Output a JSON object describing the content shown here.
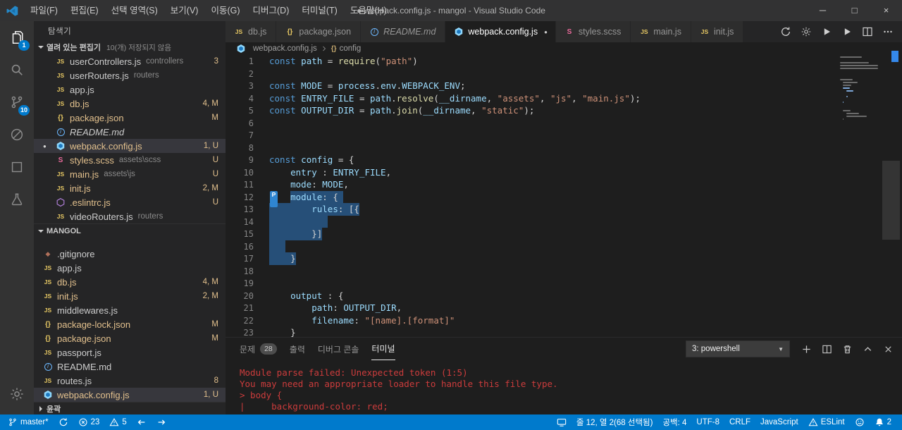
{
  "window": {
    "title": "● webpack.config.js - mangol - Visual Studio Code",
    "menus": [
      "파일(F)",
      "편집(E)",
      "선택 영역(S)",
      "보기(V)",
      "이동(G)",
      "디버그(D)",
      "터미널(T)",
      "도움말(H)"
    ],
    "controls": {
      "minimize": "─",
      "maximize": "□",
      "close": "×"
    }
  },
  "activity_bar": {
    "items": [
      {
        "id": "explorer",
        "icon": "files-icon",
        "badge": "1",
        "active": true
      },
      {
        "id": "search",
        "icon": "search-icon"
      },
      {
        "id": "source-control",
        "icon": "git-branch-icon",
        "badge": "10"
      },
      {
        "id": "debug",
        "icon": "circle-slash-icon"
      },
      {
        "id": "editor-layout",
        "icon": "square-icon"
      },
      {
        "id": "test",
        "icon": "beaker-icon"
      }
    ],
    "bottom_items": [
      {
        "id": "settings",
        "icon": "gear-icon"
      }
    ]
  },
  "sidebar": {
    "title": "탐색기",
    "open_editors": {
      "label": "열려 있는 편집기",
      "note": "10(개) 저장되지 않음",
      "items": [
        {
          "icon": "js",
          "name": "userControllers.js",
          "desc": "controllers",
          "badge": "3"
        },
        {
          "icon": "js",
          "name": "userRouters.js",
          "desc": "routers"
        },
        {
          "icon": "js",
          "name": "app.js"
        },
        {
          "icon": "js",
          "name": "db.js",
          "badge": "4, M",
          "colored": true
        },
        {
          "icon": "json",
          "name": "package.json",
          "badge": "M",
          "colored": true
        },
        {
          "icon": "info",
          "name": "README.md",
          "italic": true
        },
        {
          "icon": "webpack",
          "name": "webpack.config.js",
          "badge": "1, U",
          "colored": true,
          "selected": true,
          "dirty": true
        },
        {
          "icon": "scss",
          "name": "styles.scss",
          "desc": "assets\\scss",
          "badge": "U",
          "colored": true
        },
        {
          "icon": "js",
          "name": "main.js",
          "desc": "assets\\js",
          "badge": "U",
          "colored": true
        },
        {
          "icon": "js",
          "name": "init.js",
          "badge": "2, M",
          "colored": true
        },
        {
          "icon": "eslint",
          "name": ".eslintrc.js",
          "badge": "U",
          "colored": true
        },
        {
          "icon": "js",
          "name": "videoRouters.js",
          "desc": "routers"
        }
      ]
    },
    "folder_section": {
      "label": "MANGOL",
      "items": [
        {
          "icon": "git",
          "name": ".gitignore"
        },
        {
          "icon": "js",
          "name": "app.js"
        },
        {
          "icon": "js",
          "name": "db.js",
          "badge": "4, M",
          "colored": true
        },
        {
          "icon": "js",
          "name": "init.js",
          "badge": "2, M",
          "colored": true
        },
        {
          "icon": "js",
          "name": "middlewares.js"
        },
        {
          "icon": "json",
          "name": "package-lock.json",
          "badge": "M",
          "colored": true
        },
        {
          "icon": "json",
          "name": "package.json",
          "badge": "M",
          "colored": true
        },
        {
          "icon": "js",
          "name": "passport.js"
        },
        {
          "icon": "info",
          "name": "README.md"
        },
        {
          "icon": "js",
          "name": "routes.js",
          "badge": "8"
        },
        {
          "icon": "webpack",
          "name": "webpack.config.js",
          "badge": "1, U",
          "colored": true,
          "selected": true
        }
      ]
    },
    "outline_section": {
      "label": "윤곽"
    }
  },
  "editor": {
    "tabs": [
      {
        "icon": "js",
        "label": "db.js"
      },
      {
        "icon": "json",
        "label": "package.json"
      },
      {
        "icon": "info",
        "label": "README.md",
        "italic": true
      },
      {
        "icon": "webpack",
        "label": "webpack.config.js",
        "active": true,
        "dirty": true
      },
      {
        "icon": "scss",
        "label": "styles.scss"
      },
      {
        "icon": "js",
        "label": "main.js"
      },
      {
        "icon": "js",
        "label": "init.js"
      }
    ],
    "tab_actions": [
      "sync-icon",
      "gear-icon",
      "run-icon",
      "run-icon",
      "split-editor-icon",
      "more-icon"
    ],
    "breadcrumb": [
      {
        "icon": "webpack",
        "label": "webpack.config.js"
      },
      {
        "icon": "symbol-brackets",
        "label": "config"
      }
    ],
    "lines": [
      {
        "n": 1,
        "tokens": [
          [
            "k",
            "const"
          ],
          [
            "p",
            " "
          ],
          [
            "v",
            "path"
          ],
          [
            "p",
            " = "
          ],
          [
            "f",
            "require"
          ],
          [
            "p",
            "("
          ],
          [
            "s",
            "\"path\""
          ],
          [
            "p",
            ")"
          ]
        ]
      },
      {
        "n": 2,
        "tokens": []
      },
      {
        "n": 3,
        "tokens": [
          [
            "k",
            "const"
          ],
          [
            "p",
            " "
          ],
          [
            "v",
            "MODE"
          ],
          [
            "p",
            " = "
          ],
          [
            "v",
            "process"
          ],
          [
            "p",
            "."
          ],
          [
            "v",
            "env"
          ],
          [
            "p",
            "."
          ],
          [
            "v",
            "WEBPACK_ENV"
          ],
          [
            "p",
            ";"
          ]
        ]
      },
      {
        "n": 4,
        "tokens": [
          [
            "k",
            "const"
          ],
          [
            "p",
            " "
          ],
          [
            "v",
            "ENTRY_FILE"
          ],
          [
            "p",
            " = "
          ],
          [
            "v",
            "path"
          ],
          [
            "p",
            "."
          ],
          [
            "f",
            "resolve"
          ],
          [
            "p",
            "("
          ],
          [
            "v",
            "__dirname"
          ],
          [
            "p",
            ", "
          ],
          [
            "s",
            "\"assets\""
          ],
          [
            "p",
            ", "
          ],
          [
            "s",
            "\"js\""
          ],
          [
            "p",
            ", "
          ],
          [
            "s",
            "\"main.js\""
          ],
          [
            "p",
            ");"
          ]
        ]
      },
      {
        "n": 5,
        "tokens": [
          [
            "k",
            "const"
          ],
          [
            "p",
            " "
          ],
          [
            "v",
            "OUTPUT_DIR"
          ],
          [
            "p",
            " = "
          ],
          [
            "v",
            "path"
          ],
          [
            "p",
            "."
          ],
          [
            "f",
            "join"
          ],
          [
            "p",
            "("
          ],
          [
            "v",
            "__dirname"
          ],
          [
            "p",
            ", "
          ],
          [
            "s",
            "\"static\""
          ],
          [
            "p",
            ");"
          ]
        ]
      },
      {
        "n": 6,
        "tokens": []
      },
      {
        "n": 7,
        "tokens": []
      },
      {
        "n": 8,
        "tokens": []
      },
      {
        "n": 9,
        "tokens": [
          [
            "k",
            "const"
          ],
          [
            "p",
            " "
          ],
          [
            "v",
            "config"
          ],
          [
            "p",
            " = {"
          ]
        ]
      },
      {
        "n": 10,
        "tokens": [
          [
            "p",
            "    "
          ],
          [
            "v",
            "entry"
          ],
          [
            "p",
            " : "
          ],
          [
            "v",
            "ENTRY_FILE"
          ],
          [
            "p",
            ","
          ]
        ]
      },
      {
        "n": 11,
        "tokens": [
          [
            "p",
            "    "
          ],
          [
            "v",
            "mode"
          ],
          [
            "p",
            ": "
          ],
          [
            "v",
            "MODE"
          ],
          [
            "p",
            ","
          ]
        ]
      },
      {
        "n": 12,
        "tokens": [
          [
            "p",
            "    "
          ],
          [
            "v",
            "module"
          ],
          [
            "p",
            ": {"
          ]
        ],
        "sel": [
          4,
          14
        ],
        "flag": "P"
      },
      {
        "n": 13,
        "tokens": [
          [
            "p",
            "        "
          ],
          [
            "v",
            "rules"
          ],
          [
            "p",
            ": [{"
          ]
        ],
        "sel": [
          0,
          17
        ]
      },
      {
        "n": 14,
        "tokens": [],
        "sel": [
          0,
          11
        ]
      },
      {
        "n": 15,
        "tokens": [
          [
            "p",
            "        }]"
          ]
        ],
        "sel": [
          0,
          10
        ]
      },
      {
        "n": 16,
        "tokens": [],
        "sel": [
          0,
          3
        ]
      },
      {
        "n": 17,
        "tokens": [
          [
            "p",
            "    }"
          ]
        ],
        "sel": [
          0,
          5
        ]
      },
      {
        "n": 18,
        "tokens": []
      },
      {
        "n": 19,
        "tokens": []
      },
      {
        "n": 20,
        "tokens": [
          [
            "p",
            "    "
          ],
          [
            "v",
            "output"
          ],
          [
            "p",
            " : {"
          ]
        ]
      },
      {
        "n": 21,
        "tokens": [
          [
            "p",
            "        "
          ],
          [
            "v",
            "path"
          ],
          [
            "p",
            ": "
          ],
          [
            "v",
            "OUTPUT_DIR"
          ],
          [
            "p",
            ","
          ]
        ]
      },
      {
        "n": 22,
        "tokens": [
          [
            "p",
            "        "
          ],
          [
            "v",
            "filename"
          ],
          [
            "p",
            ": "
          ],
          [
            "s",
            "\"[name].[format]\""
          ]
        ]
      },
      {
        "n": 23,
        "tokens": [
          [
            "p",
            "    }"
          ]
        ]
      }
    ]
  },
  "panel": {
    "tabs": [
      {
        "label": "문제",
        "badge": "28"
      },
      {
        "label": "출력"
      },
      {
        "label": "디버그 콘솔"
      },
      {
        "label": "터미널",
        "active": true
      }
    ],
    "terminal_select": "3: powershell",
    "actions": [
      "plus-icon",
      "split-editor-icon",
      "trash-icon",
      "chevron-up-icon",
      "close-icon"
    ],
    "terminal_lines": [
      "Module parse failed: Unexpected token (1:5)",
      "You may need an appropriate loader to handle this file type.",
      "> body {",
      "|     background-color: red;"
    ]
  },
  "status_bar": {
    "left": [
      {
        "name": "git-branch",
        "icon": "git-branch-icon",
        "label": "master*"
      },
      {
        "name": "sync",
        "icon": "sync-icon",
        "label": ""
      },
      {
        "name": "errors",
        "icon": "error-icon",
        "label": "23"
      },
      {
        "name": "warnings",
        "icon": "warning-icon",
        "label": "5"
      },
      {
        "name": "nav-back",
        "icon": "arrow-left-icon",
        "label": ""
      },
      {
        "name": "nav-forward",
        "icon": "arrow-right-icon",
        "label": ""
      }
    ],
    "right": [
      {
        "name": "screencast",
        "icon": "screencast-icon",
        "label": ""
      },
      {
        "name": "cursor-position",
        "label": "줄 12, 열 2(68 선택됨)"
      },
      {
        "name": "indentation",
        "label": "공백: 4"
      },
      {
        "name": "encoding",
        "label": "UTF-8"
      },
      {
        "name": "eol",
        "label": "CRLF"
      },
      {
        "name": "language-mode",
        "label": "JavaScript"
      },
      {
        "name": "eslint",
        "icon": "warning-icon",
        "label": "ESLint"
      },
      {
        "name": "feedback",
        "icon": "smiley-icon",
        "label": ""
      },
      {
        "name": "notifications",
        "icon": "bell-icon",
        "label": "2"
      }
    ]
  },
  "colors": {
    "status_bar": "#007acc",
    "accent": "#007acc",
    "selection": "#264f78",
    "git_badge": "#e2c08d",
    "terminal_error": "#cd3c3c"
  }
}
